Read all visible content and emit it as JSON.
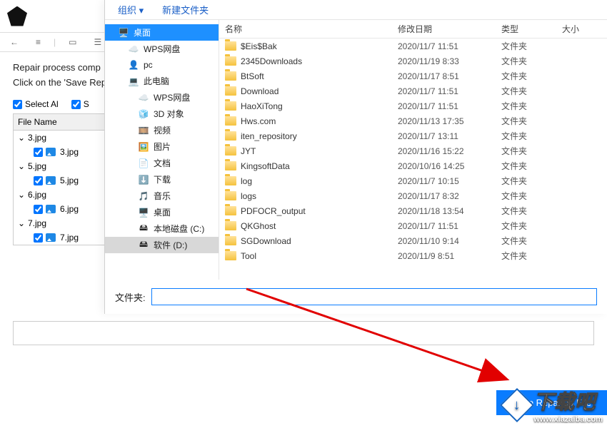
{
  "app": {
    "msg1": "Repair process comp",
    "msg2": "Click on the 'Save Rep",
    "select_all": "Select Al",
    "select_s": "S",
    "file_table_header": "File Name",
    "files": [
      {
        "parent": "3.jpg",
        "child": "3.jpg"
      },
      {
        "parent": "5.jpg",
        "child": "5.jpg"
      },
      {
        "parent": "6.jpg",
        "child": "6.jpg"
      },
      {
        "parent": "7.jpg",
        "child": "7.jpg"
      }
    ],
    "save_button": "Save Repaired File"
  },
  "dialog": {
    "menu_organize": "组织 ▾",
    "menu_newfolder": "新建文件夹",
    "tree": [
      {
        "label": "桌面",
        "level": 0,
        "icon": "desktop",
        "hl": true
      },
      {
        "label": "WPS网盘",
        "level": 1,
        "icon": "wps"
      },
      {
        "label": "pc",
        "level": 1,
        "icon": "user"
      },
      {
        "label": "此电脑",
        "level": 1,
        "icon": "thispc"
      },
      {
        "label": "WPS网盘",
        "level": 2,
        "icon": "wps"
      },
      {
        "label": "3D 对象",
        "level": 2,
        "icon": "3d"
      },
      {
        "label": "视频",
        "level": 2,
        "icon": "video"
      },
      {
        "label": "图片",
        "level": 2,
        "icon": "picture"
      },
      {
        "label": "文档",
        "level": 2,
        "icon": "doc"
      },
      {
        "label": "下载",
        "level": 2,
        "icon": "download"
      },
      {
        "label": "音乐",
        "level": 2,
        "icon": "music"
      },
      {
        "label": "桌面",
        "level": 2,
        "icon": "desktop2"
      },
      {
        "label": "本地磁盘 (C:)",
        "level": 2,
        "icon": "disk"
      },
      {
        "label": "软件 (D:)",
        "level": 2,
        "icon": "disk",
        "selected": true
      }
    ],
    "columns": {
      "name": "名称",
      "date": "修改日期",
      "type": "类型",
      "size": "大小"
    },
    "rows": [
      {
        "name": "$Eis$Bak",
        "date": "2020/11/7 11:51",
        "type": "文件夹"
      },
      {
        "name": "2345Downloads",
        "date": "2020/11/19 8:33",
        "type": "文件夹"
      },
      {
        "name": "BtSoft",
        "date": "2020/11/17 8:51",
        "type": "文件夹"
      },
      {
        "name": "Download",
        "date": "2020/11/7 11:51",
        "type": "文件夹"
      },
      {
        "name": "HaoXiTong",
        "date": "2020/11/7 11:51",
        "type": "文件夹"
      },
      {
        "name": "Hws.com",
        "date": "2020/11/13 17:35",
        "type": "文件夹"
      },
      {
        "name": "iten_repository",
        "date": "2020/11/7 13:11",
        "type": "文件夹"
      },
      {
        "name": "JYT",
        "date": "2020/11/16 15:22",
        "type": "文件夹"
      },
      {
        "name": "KingsoftData",
        "date": "2020/10/16 14:25",
        "type": "文件夹"
      },
      {
        "name": "log",
        "date": "2020/11/7 10:15",
        "type": "文件夹"
      },
      {
        "name": "logs",
        "date": "2020/11/17 8:32",
        "type": "文件夹"
      },
      {
        "name": "PDFOCR_output",
        "date": "2020/11/18 13:54",
        "type": "文件夹"
      },
      {
        "name": "QKGhost",
        "date": "2020/11/7 11:51",
        "type": "文件夹"
      },
      {
        "name": "SGDownload",
        "date": "2020/11/10 9:14",
        "type": "文件夹"
      },
      {
        "name": "Tool",
        "date": "2020/11/9 8:51",
        "type": "文件夹"
      }
    ],
    "footer_label": "文件夹:",
    "footer_value": ""
  },
  "watermark": {
    "text": "下载吧",
    "url": "www.xiazaiba.com"
  }
}
